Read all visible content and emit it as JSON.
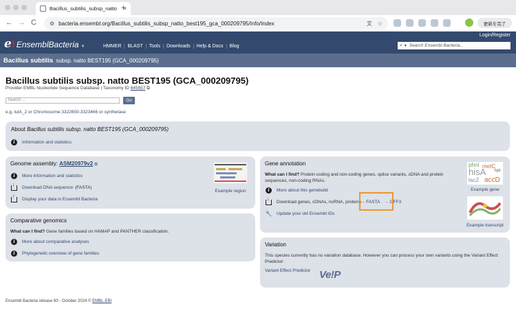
{
  "browser": {
    "tab_title": "Bacillus_subtilis_subsp_natto",
    "tab_close": "×",
    "new_tab": "+",
    "url": "bacteria.ensembl.org/Bacillus_subtilis_subsp_natto_best195_gca_000209795/Info/Index",
    "update_button": "更新を完了",
    "back": "←",
    "forward": "→",
    "reload": "C"
  },
  "header": {
    "logo_e": "e",
    "logo_bang": "!",
    "logo_brand": "EnsemblBacteria",
    "logo_caret": "▼",
    "login": "Login/Register",
    "nav": [
      "HMMER",
      "BLAST",
      "Tools",
      "Downloads",
      "Help & Docs",
      "Blog"
    ],
    "search_placeholder": "Search Ensembl Bacteria..."
  },
  "species_bar": {
    "name": "Bacillus subtilis",
    "strain": "subsp. natto BEST195 (GCA_000209795)"
  },
  "main": {
    "title": "Bacillus subtilis subsp. natto BEST195 (GCA_000209795)",
    "provider_text": "Provider EMBL Nucleotide Sequence Database | Taxonomy ID",
    "taxonomy_id": "645657",
    "search_placeholder": "Search ...",
    "go_label": "Go",
    "examples_prefix": "e.g.",
    "example_1": "lutA_2",
    "or_1": "or",
    "example_2": "Chromosome:3322650-3323466",
    "or_2": "or",
    "example_3": "synthetase"
  },
  "about": {
    "title_prefix": "About",
    "title_species": "Bacillus subtilis subsp. natto BEST195 (GCA_000209795)",
    "link": "Information and statistics"
  },
  "assembly": {
    "title": "Genome assembly:",
    "assembly_name": "ASM20979v2",
    "link_more": "More information and statistics",
    "link_download": "Download DNA sequence",
    "download_suffix": "(FASTA)",
    "link_display": "Display your data in Ensembl Bacteria",
    "example_region": "Example region"
  },
  "comparative": {
    "title": "Comparative genomics",
    "what_label": "What can I find?",
    "what_text": "Gene families based on HAMAP and PANTHER classification.",
    "link_more": "More about comparative analyses",
    "link_phylo": "Phylogenetic overview of gene families"
  },
  "annotation": {
    "title": "Gene annotation",
    "what_label": "What can I find?",
    "what_text": "Protein-coding and non-coding genes, splice variants, cDNA and protein sequences, non-coding RNAs.",
    "link_genebuild": "More about this genebuild",
    "download_text": "Download genes, cDNAs, ncRNA, proteins -",
    "link_fasta": "FASTA",
    "sep": "-",
    "link_gff3": "GFF3",
    "link_update": "Update your old Ensembl IDs",
    "example_gene": "Example gene",
    "example_transcript": "Example transcript",
    "gene_words": [
      "phnI",
      "metC",
      "hpt",
      "hisA",
      "lacZ",
      "accD"
    ]
  },
  "variation": {
    "title": "Variation",
    "text": "This species currently has no variation database. However you can process your own variants using the Variant Effect Predictor:",
    "link_vep": "Variant Effect Predictor",
    "vep_logo": "Ve!P"
  },
  "footer": {
    "text": "Ensembl Bacteria release 60 - October 2024 ©",
    "link": "EMBL-EBI"
  }
}
